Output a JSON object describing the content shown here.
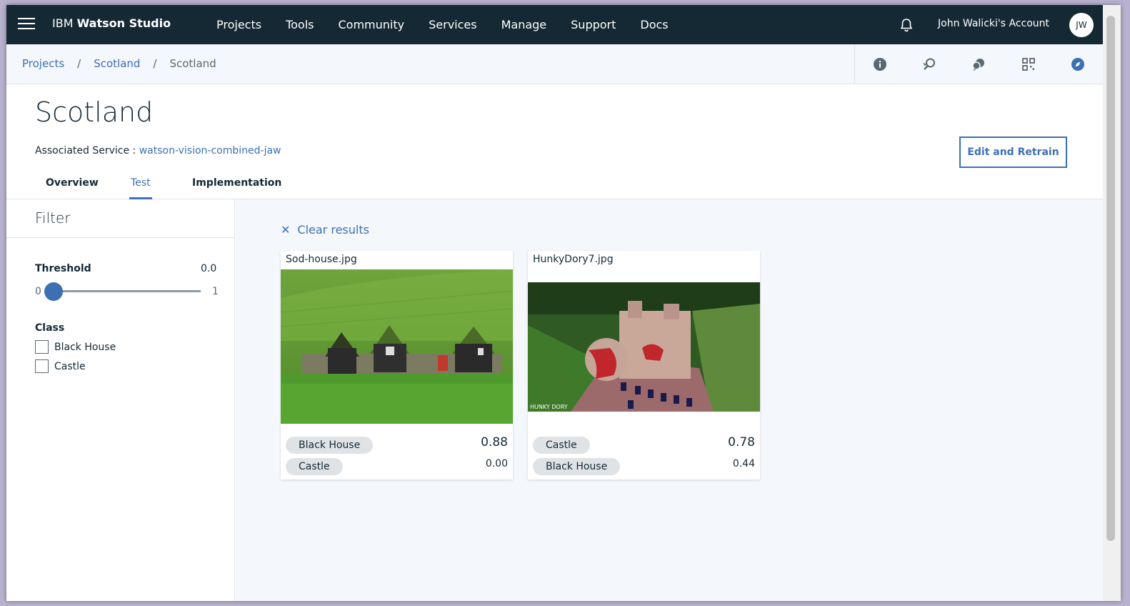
{
  "header": {
    "brand_prefix": "IBM",
    "brand_name": "Watson Studio",
    "nav": [
      "Projects",
      "Tools",
      "Community",
      "Services",
      "Manage",
      "Support",
      "Docs"
    ],
    "account": "John Walicki's Account",
    "avatar_initials": "JW"
  },
  "breadcrumb": {
    "items": [
      "Projects",
      "Scotland",
      "Scotland"
    ],
    "separator": "/"
  },
  "toolbar": {
    "icons": [
      "info-icon",
      "search-history-icon",
      "chat-icon",
      "app-switcher-icon",
      "compass-icon"
    ]
  },
  "project": {
    "title": "Scotland",
    "assoc_label": "Associated Service :",
    "assoc_service": "watson-vision-combined-jaw",
    "retrain_label": "Edit and Retrain"
  },
  "tabs": [
    {
      "label": "Overview",
      "active": false
    },
    {
      "label": "Test",
      "active": true
    },
    {
      "label": "Implementation",
      "active": false
    }
  ],
  "filter": {
    "title": "Filter",
    "threshold_label": "Threshold",
    "threshold_value": "0.0",
    "slider_min": "0",
    "slider_max": "1",
    "threshold_fraction": 0.0,
    "class_label": "Class",
    "classes": [
      {
        "label": "Black House",
        "checked": false
      },
      {
        "label": "Castle",
        "checked": false
      }
    ]
  },
  "results": {
    "clear_label": "Clear results",
    "cards": [
      {
        "filename": "Sod-house.jpg",
        "scores": [
          {
            "class": "Black House",
            "score": "0.88"
          },
          {
            "class": "Castle",
            "score": "0.00"
          }
        ]
      },
      {
        "filename": "HunkyDory7.jpg",
        "scores": [
          {
            "class": "Castle",
            "score": "0.78"
          },
          {
            "class": "Black House",
            "score": "0.44"
          }
        ],
        "watermark": "HUNKY DORY"
      }
    ]
  },
  "colors": {
    "header_bg": "#152935",
    "accent": "#3d70b2",
    "panel_bg": "#f4f7fb"
  }
}
